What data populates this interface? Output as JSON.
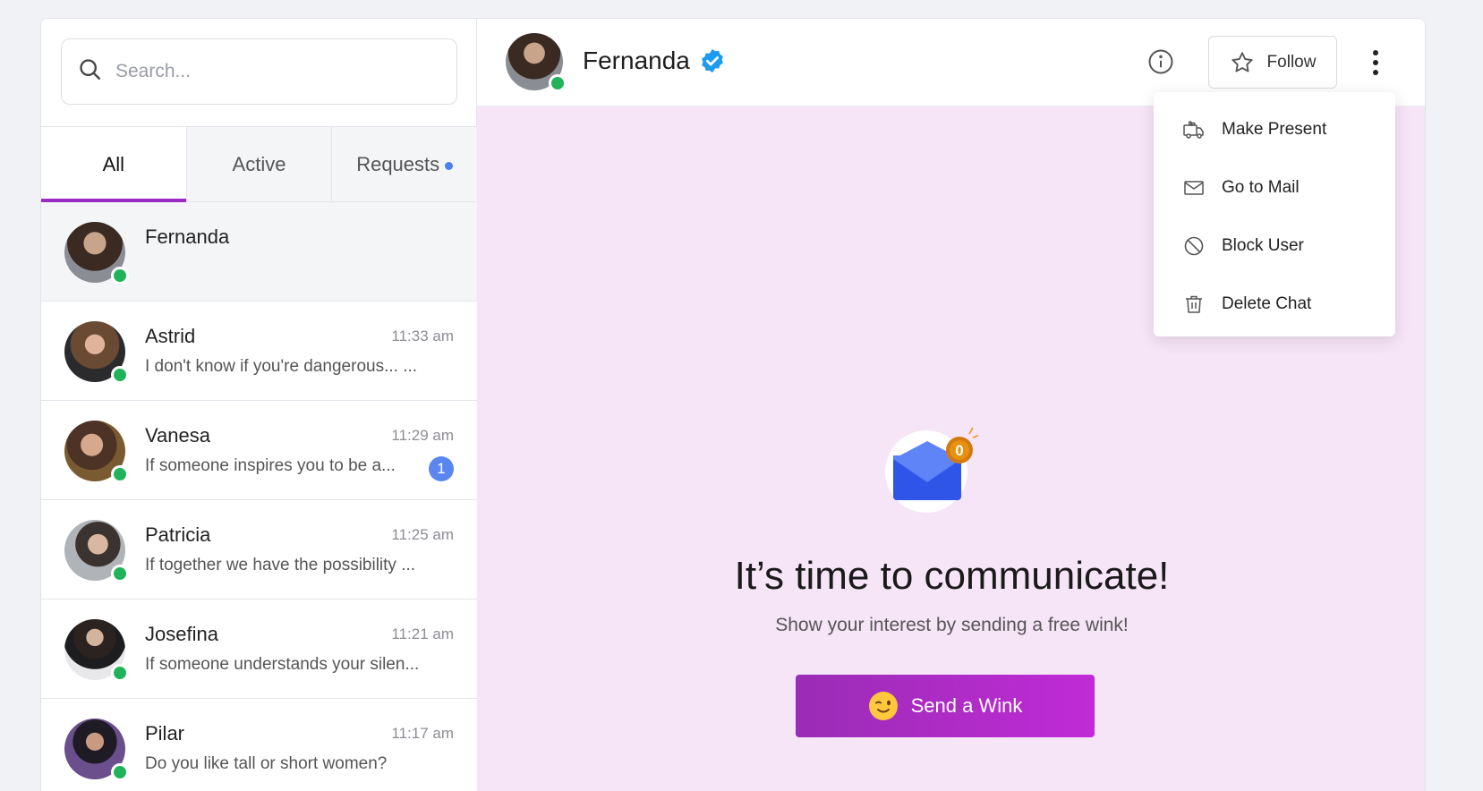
{
  "search": {
    "placeholder": "Search..."
  },
  "tabs": [
    {
      "label": "All",
      "active": true
    },
    {
      "label": "Active",
      "active": false
    },
    {
      "label": "Requests",
      "active": false,
      "has_dot": true
    }
  ],
  "chats": [
    {
      "name": "Fernanda",
      "time": "",
      "preview": "",
      "unread": "",
      "online": true,
      "selected": true
    },
    {
      "name": "Astrid",
      "time": "11:33 am",
      "preview": "I don't know if you're dangerous... ...",
      "unread": "",
      "online": true
    },
    {
      "name": "Vanesa",
      "time": "11:29 am",
      "preview": "If someone inspires you to be a...",
      "unread": "1",
      "online": true
    },
    {
      "name": "Patricia",
      "time": "11:25 am",
      "preview": "If together we have the possibility ...",
      "unread": "",
      "online": true
    },
    {
      "name": "Josefina",
      "time": "11:21 am",
      "preview": "If someone understands your silen...",
      "unread": "",
      "online": true
    },
    {
      "name": "Pilar",
      "time": "11:17 am",
      "preview": "Do you like tall or short women?",
      "unread": "",
      "online": true
    }
  ],
  "header": {
    "name": "Fernanda",
    "verified": true,
    "follow_label": "Follow"
  },
  "menu": {
    "items": [
      {
        "label": "Make Present",
        "icon": "gift-truck-icon"
      },
      {
        "label": "Go to Mail",
        "icon": "mail-icon"
      },
      {
        "label": "Block User",
        "icon": "block-icon"
      },
      {
        "label": "Delete Chat",
        "icon": "trash-icon"
      }
    ]
  },
  "empty_state": {
    "badge_count": "0",
    "headline": "It’s time to communicate!",
    "subline": "Show your interest by sending a free wink!",
    "button_label": "Send a Wink"
  },
  "colors": {
    "accent": "#9b2bc4",
    "content_bg": "#f6e4f7",
    "online": "#21b35b",
    "unread": "#5b86ef",
    "verified": "#1d9bf0"
  }
}
